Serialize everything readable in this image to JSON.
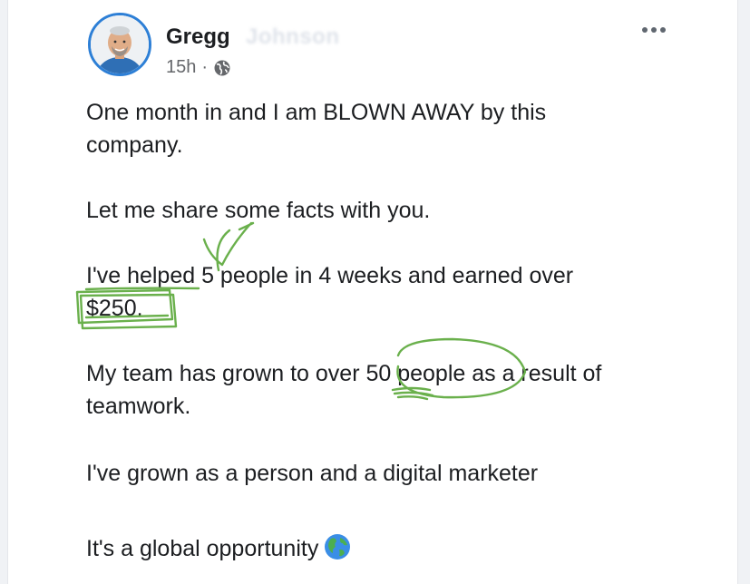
{
  "post": {
    "author": "Gregg",
    "author_blurred": "Johnson",
    "time": "15h",
    "separator": "·",
    "privacy_icon": "globe-icon",
    "more_icon": "more-dots-icon",
    "lines": [
      "One month in and I am BLOWN AWAY by this",
      "company.",
      "Let me share some facts with you.",
      "I've helped 5 people in 4 weeks and earned over",
      "$250.",
      "My team has grown to over 50 people as a result of",
      "teamwork.",
      "I've grown as a person and a digital marketer",
      "It's a global opportunity"
    ],
    "emoji": "earth-globe-emoji"
  },
  "colors": {
    "annotation": "#6ab04c",
    "avatar_ring": "#2d7fd6",
    "text": "#1c1e21",
    "meta": "#65676b"
  }
}
